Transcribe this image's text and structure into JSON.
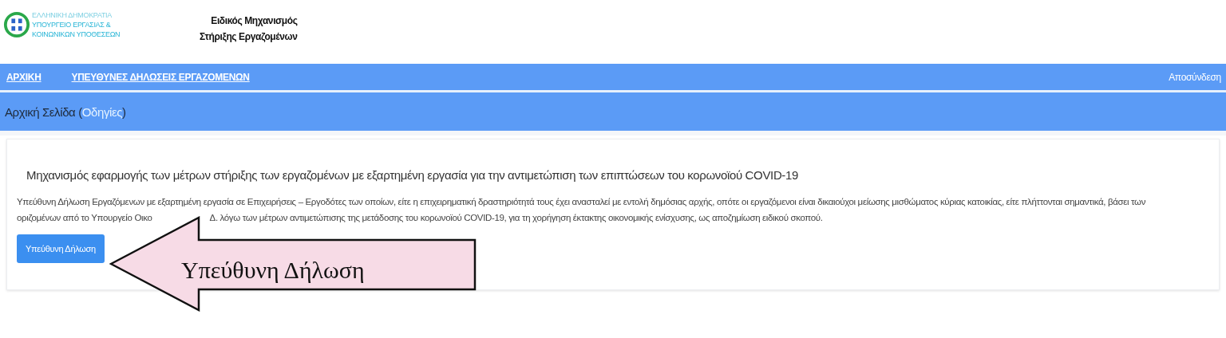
{
  "header": {
    "ministry_lines": [
      "ΕΛΛΗΝΙΚΗ ΔΗΜΟΚΡΑΤΙΑ",
      "ΥΠΟΥΡΓΕΙΟ ΕΡΓΑΣΙΑΣ &",
      "ΚΟΙΝΩΝΙΚΩΝ ΥΠΟΘΕΣΕΩΝ"
    ],
    "title_lines": [
      "Ειδικός Μηχανισμός",
      "Στήριξης Εργαζομένων"
    ]
  },
  "nav": {
    "links": [
      {
        "label": "ΑΡΧΙΚΗ"
      },
      {
        "label": "ΥΠΕΥΘΥΝΕΣ ΔΗΛΩΣΕΙΣ ΕΡΓΑΖΟΜΕΝΩΝ"
      }
    ],
    "logout": "Αποσύνδεση"
  },
  "breadcrumb": {
    "title": "Αρχική Σελίδα (",
    "link": "Οδηγίες",
    "close": ")"
  },
  "card": {
    "heading": "Μηχανισμός εφαρμογής των μέτρων στήριξης των εργαζομένων με εξαρτημένη εργασία για την αντιμετώπιση των επιπτώσεων του κορωνοϊού COVID-19",
    "line_1": "Υπεύθυνη Δήλωση Εργαζόμενων με εξαρτημένη εργασία σε Επιχειρήσεις – Εργοδότες των οποίων, είτε η επιχειρηματική δραστηριότητά τους έχει ανασταλεί με εντολή δημόσιας αρχής, οπότε οι εργαζόμενοι είναι δικαιούχοι μείωσης μισθώματος κύριας κατοικίας, είτε πλήττονται σημαντικά, βάσει των",
    "line_2_parts": [
      "οριζομένων από το Υπουργείο Οικο",
      "Δ. λόγω των μέτρων αντιμετώπισης της μετάδοσης του κορωνοϊού COVID-19, για τη χορήγηση έκτακτης οικονομικής ενίσχυσης, ως αποζημίωση ειδικού σκοπού."
    ],
    "button": "Υπεύθυνη Δήλωση"
  },
  "callout": {
    "label": "Υπεύθυνη Δήλωση"
  }
}
